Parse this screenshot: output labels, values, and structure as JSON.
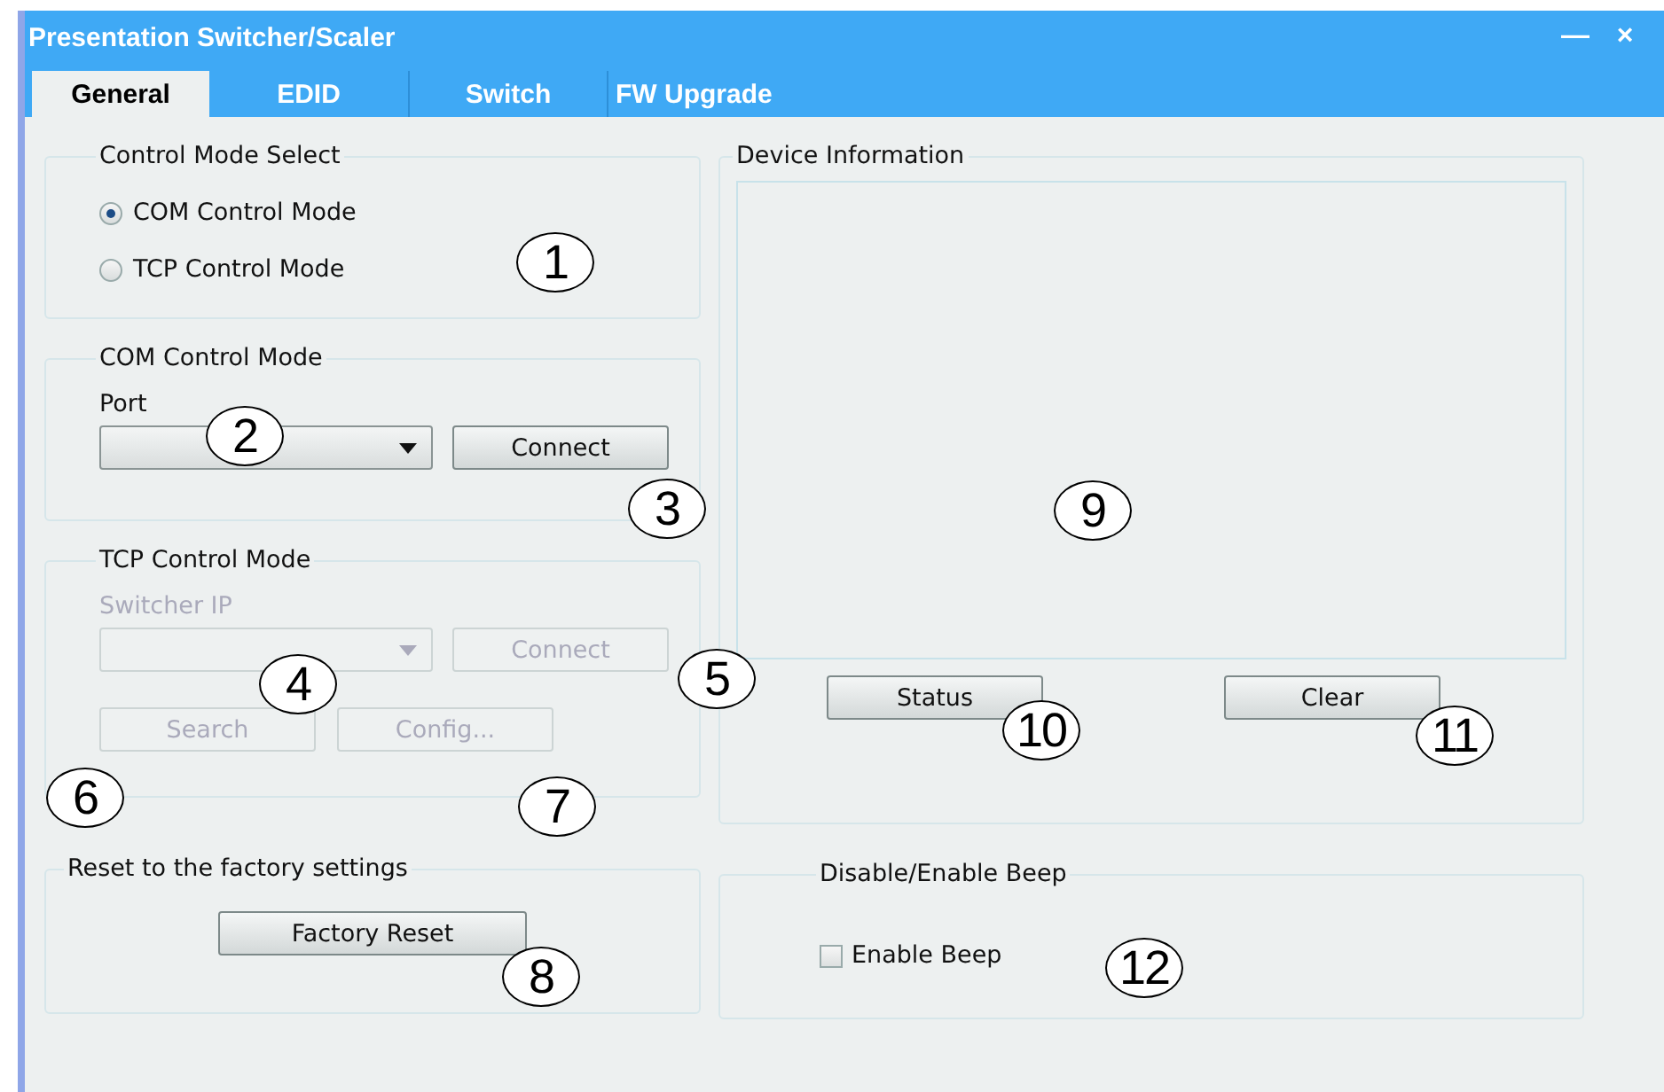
{
  "window": {
    "title": "Presentation Switcher/Scaler",
    "controls": [
      "—",
      "×"
    ]
  },
  "tabs": [
    {
      "label": "General",
      "selected": true
    },
    {
      "label": "EDID",
      "selected": false
    },
    {
      "label": "Switch",
      "selected": false
    },
    {
      "label": "FW Upgrade",
      "selected": false
    }
  ],
  "control_mode_select": {
    "title": "Control Mode Select",
    "options": [
      {
        "label": "COM Control Mode",
        "selected": true
      },
      {
        "label": "TCP Control Mode",
        "selected": false
      }
    ]
  },
  "com_control_mode": {
    "title": "COM Control Mode",
    "disabled": false,
    "field_label": "Port",
    "button": "Connect"
  },
  "tcp_control_mode": {
    "title": "TCP Control Mode",
    "disabled": true,
    "field_label": "Switcher IP",
    "button": "Connect",
    "buttons": [
      "Search",
      "Config..."
    ]
  },
  "device_information": {
    "title": "Device Information",
    "buttons": [
      "Status",
      "Clear"
    ]
  },
  "factory_reset": {
    "title": "Reset to the factory settings",
    "button": "Factory Reset"
  },
  "beep": {
    "title": "Disable/Enable Beep",
    "checkbox": {
      "label": "Enable Beep",
      "checked": false
    }
  },
  "callouts": [
    "1",
    "2",
    "3",
    "4",
    "5",
    "6",
    "7",
    "8",
    "9",
    "10",
    "11",
    "12"
  ]
}
